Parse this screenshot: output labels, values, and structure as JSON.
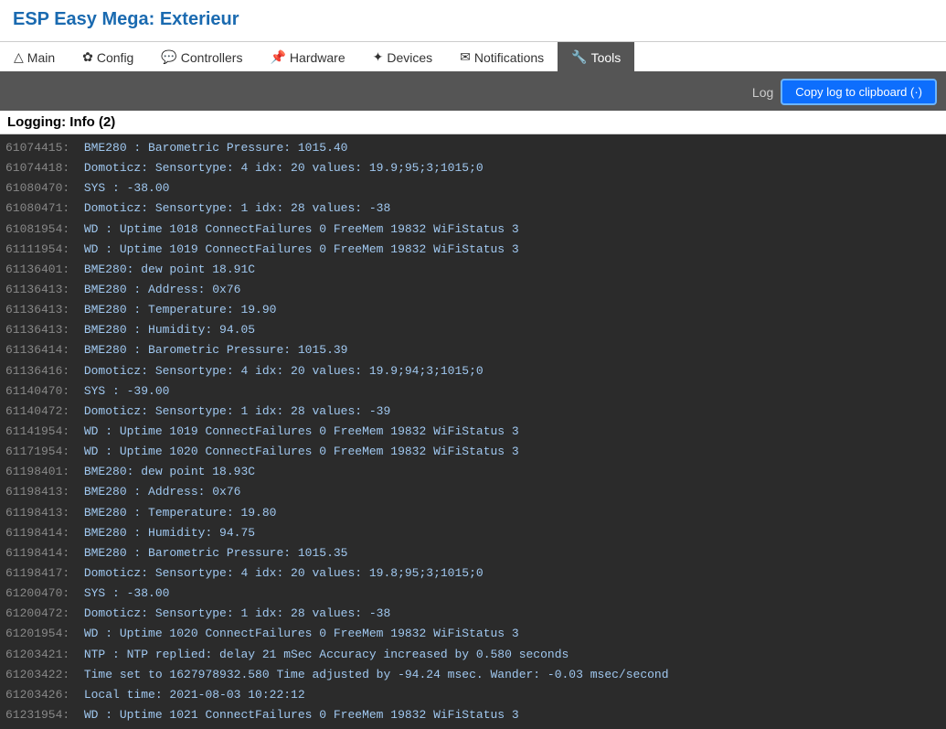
{
  "header": {
    "title": "ESP Easy Mega: Exterieur"
  },
  "nav": {
    "items": [
      {
        "label": "△Main",
        "icon": "",
        "active": false
      },
      {
        "label": "✿Config",
        "icon": "",
        "active": false
      },
      {
        "label": "💬 Controllers",
        "icon": "",
        "active": false
      },
      {
        "label": "📌 Hardware",
        "icon": "",
        "active": false
      },
      {
        "label": "✦ Devices",
        "icon": "",
        "active": false
      },
      {
        "label": "✉ Notifications",
        "icon": "",
        "active": false
      },
      {
        "label": "🔧 Tools",
        "icon": "",
        "active": true
      }
    ]
  },
  "toolbar": {
    "log_label": "Log",
    "clipboard_button": "Copy log to clipboard (·)"
  },
  "log": {
    "heading": "Logging: Info (2)",
    "lines": [
      "61074415:  BME280 : Barometric Pressure: 1015.40",
      "61074418:  Domoticz: Sensortype: 4 idx: 20 values: 19.9;95;3;1015;0",
      "61080470:  SYS : -38.00",
      "61080471:  Domoticz: Sensortype: 1 idx: 28 values: -38",
      "61081954:  WD : Uptime 1018 ConnectFailures 0 FreeMem 19832 WiFiStatus 3",
      "61111954:  WD : Uptime 1019 ConnectFailures 0 FreeMem 19832 WiFiStatus 3",
      "61136401:  BME280: dew point 18.91C",
      "61136413:  BME280 : Address: 0x76",
      "61136413:  BME280 : Temperature: 19.90",
      "61136413:  BME280 : Humidity: 94.05",
      "61136414:  BME280 : Barometric Pressure: 1015.39",
      "61136416:  Domoticz: Sensortype: 4 idx: 20 values: 19.9;94;3;1015;0",
      "61140470:  SYS : -39.00",
      "61140472:  Domoticz: Sensortype: 1 idx: 28 values: -39",
      "61141954:  WD : Uptime 1019 ConnectFailures 0 FreeMem 19832 WiFiStatus 3",
      "61171954:  WD : Uptime 1020 ConnectFailures 0 FreeMem 19832 WiFiStatus 3",
      "61198401:  BME280: dew point 18.93C",
      "61198413:  BME280 : Address: 0x76",
      "61198413:  BME280 : Temperature: 19.80",
      "61198414:  BME280 : Humidity: 94.75",
      "61198414:  BME280 : Barometric Pressure: 1015.35",
      "61198417:  Domoticz: Sensortype: 4 idx: 20 values: 19.8;95;3;1015;0",
      "61200470:  SYS : -38.00",
      "61200472:  Domoticz: Sensortype: 1 idx: 28 values: -38",
      "61201954:  WD : Uptime 1020 ConnectFailures 0 FreeMem 19832 WiFiStatus 3",
      "61203421:  NTP : NTP replied: delay 21 mSec Accuracy increased by 0.580 seconds",
      "61203422:  Time set to 1627978932.580 Time adjusted by -94.24 msec. Wander: -0.03 msec/second",
      "61203426:  Local time: 2021-08-03 10:22:12",
      "61231954:  WD : Uptime 1021 ConnectFailures 0 FreeMem 19832 WiFiStatus 3"
    ]
  }
}
